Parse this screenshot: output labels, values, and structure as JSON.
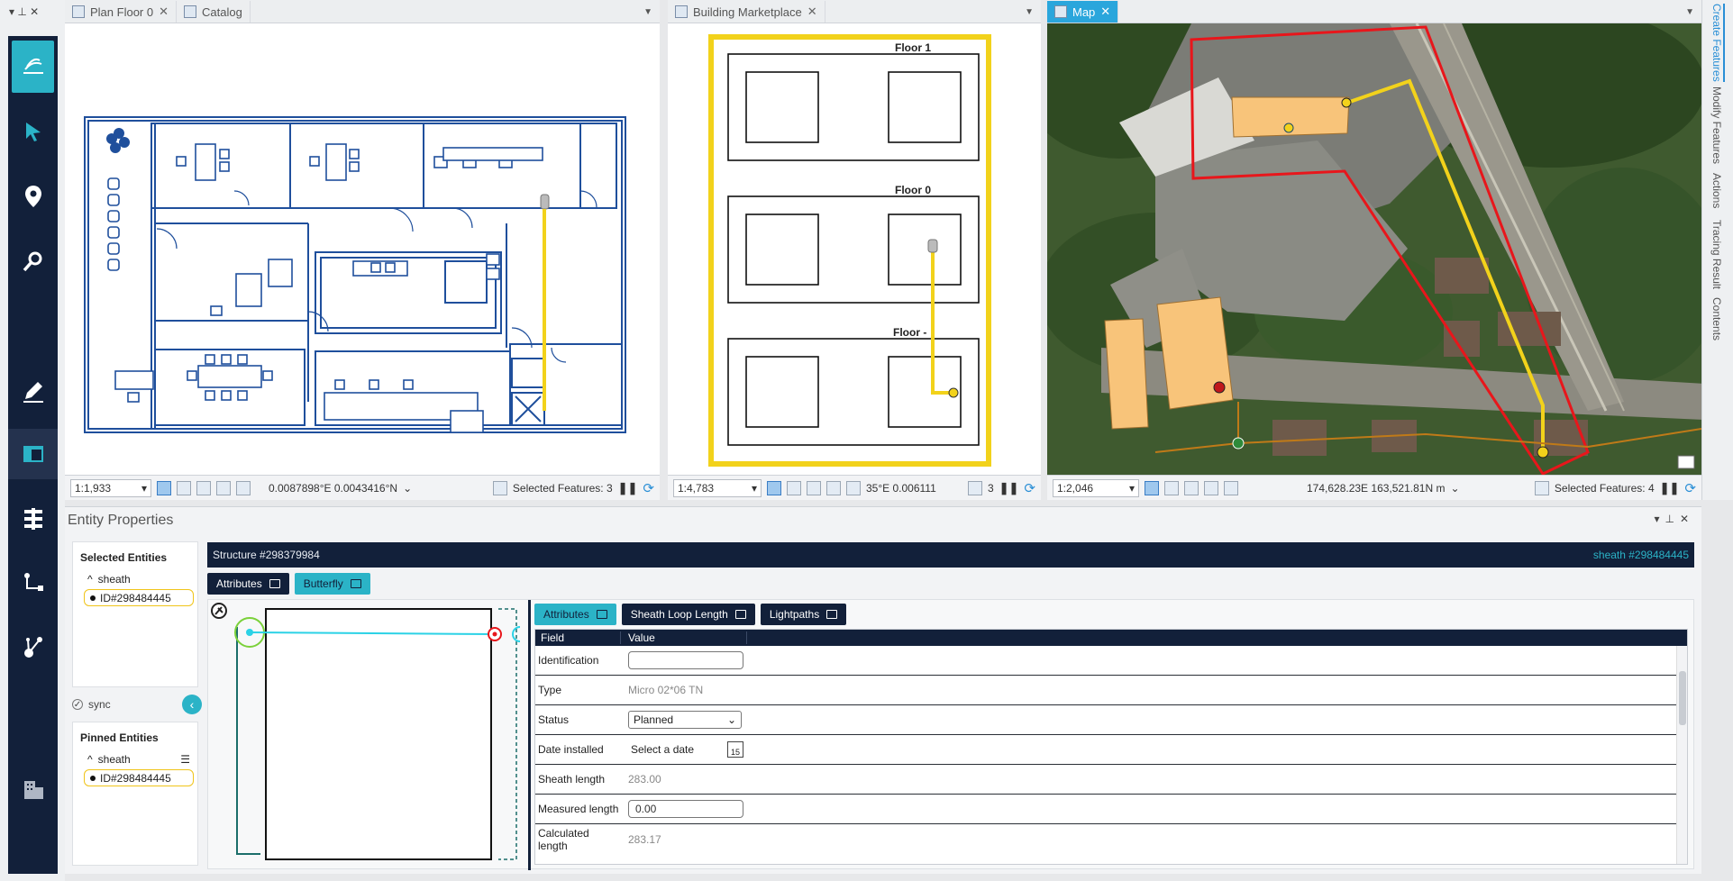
{
  "panes": {
    "left": {
      "tabs": [
        {
          "label": "Plan Floor 0"
        },
        {
          "label": "Catalog"
        }
      ],
      "scale": "1:1,933",
      "coords": "0.0087898°E 0.0043416°N",
      "selected": "Selected Features: 3"
    },
    "middle": {
      "tabs": [
        {
          "label": "Building Marketplace"
        }
      ],
      "scale": "1:4,783",
      "coords": "35°E 0.006111",
      "selected": "3",
      "floors": [
        "Floor 1",
        "Floor 0",
        "Floor -"
      ]
    },
    "right": {
      "tabs": [
        {
          "label": "Map"
        }
      ],
      "scale": "1:2,046",
      "coords": "174,628.23E 163,521.81N m",
      "selected": "Selected Features: 4"
    }
  },
  "side_tabs": [
    "Create Features",
    "Modify Features",
    "Actions",
    "Tracing Result",
    "Contents"
  ],
  "rail_icons": [
    "measure-icon",
    "select-arrow-icon",
    "location-pin-icon",
    "search-icon",
    "edit-pencil-icon",
    "layout-icon",
    "hierarchy-icon",
    "trace-icon",
    "network-icon",
    "building-icon"
  ],
  "entity_properties": {
    "title": "Entity Properties",
    "selected_heading": "Selected Entities",
    "selected_group": "sheath",
    "selected_id": "ID#298484445",
    "sync_label": "sync",
    "pinned_heading": "Pinned Entities",
    "pinned_group": "sheath",
    "pinned_id": "ID#298484445",
    "structure": "Structure #298379984",
    "structure_right": "sheath #298484445",
    "top_buttons": {
      "attributes": "Attributes",
      "butterfly": "Butterfly"
    },
    "sub_tabs": {
      "attributes": "Attributes",
      "loop": "Sheath Loop Length",
      "lightpaths": "Lightpaths"
    },
    "grid_headers": {
      "field": "Field",
      "value": "Value"
    },
    "rows": {
      "identification": {
        "field": "Identification",
        "value": ""
      },
      "type": {
        "field": "Type",
        "value": "Micro 02*06 TN"
      },
      "status": {
        "field": "Status",
        "value": "Planned"
      },
      "date": {
        "field": "Date installed",
        "value": "Select a date",
        "cal": "15"
      },
      "sheath_length": {
        "field": "Sheath length",
        "value": "283.00"
      },
      "measured": {
        "field": "Measured length",
        "value": "0.00"
      },
      "calculated": {
        "field": "Calculated length",
        "value": "283.17"
      }
    }
  },
  "colors": {
    "accent": "#2bb3c7",
    "navy": "#12203a",
    "route": "#f2d21b",
    "boundary": "#e8161b"
  }
}
